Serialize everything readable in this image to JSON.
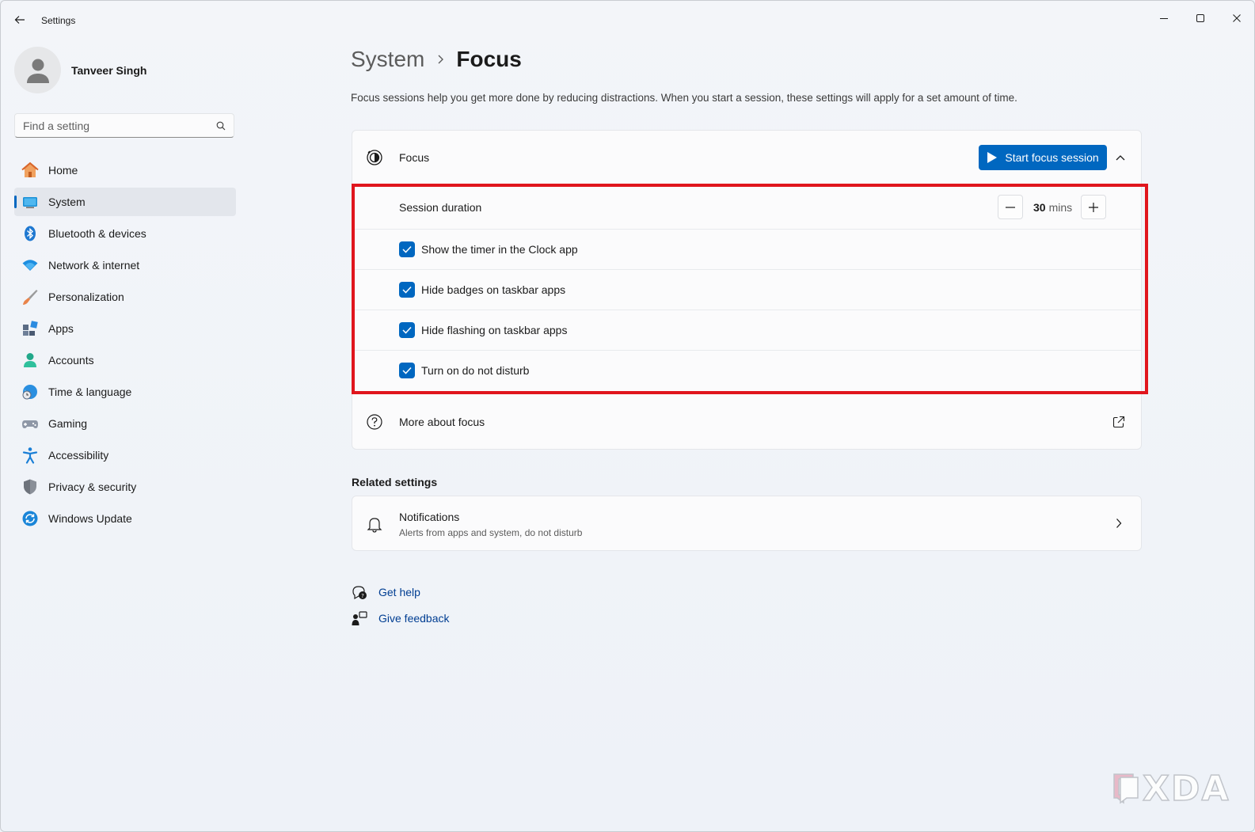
{
  "window": {
    "app_title": "Settings"
  },
  "profile": {
    "user_name": "Tanveer Singh"
  },
  "search": {
    "placeholder": "Find a setting"
  },
  "sidebar": {
    "items": [
      {
        "label": "Home",
        "icon": "home-icon"
      },
      {
        "label": "System",
        "icon": "system-icon",
        "active": true
      },
      {
        "label": "Bluetooth & devices",
        "icon": "bluetooth-icon"
      },
      {
        "label": "Network & internet",
        "icon": "wifi-icon"
      },
      {
        "label": "Personalization",
        "icon": "brush-icon"
      },
      {
        "label": "Apps",
        "icon": "apps-icon"
      },
      {
        "label": "Accounts",
        "icon": "accounts-icon"
      },
      {
        "label": "Time & language",
        "icon": "globe-clock-icon"
      },
      {
        "label": "Gaming",
        "icon": "gamepad-icon"
      },
      {
        "label": "Accessibility",
        "icon": "accessibility-icon"
      },
      {
        "label": "Privacy & security",
        "icon": "shield-icon"
      },
      {
        "label": "Windows Update",
        "icon": "update-icon"
      }
    ]
  },
  "breadcrumb": {
    "parent": "System",
    "current": "Focus"
  },
  "page": {
    "description": "Focus sessions help you get more done by reducing distractions. When you start a session, these settings will apply for a set amount of time."
  },
  "focus_card": {
    "title": "Focus",
    "start_button": "Start focus session",
    "session_duration_label": "Session duration",
    "session_value": "30",
    "session_unit": "mins",
    "options": [
      {
        "label": "Show the timer in the Clock app",
        "checked": true
      },
      {
        "label": "Hide badges on taskbar apps",
        "checked": true
      },
      {
        "label": "Hide flashing on taskbar apps",
        "checked": true
      },
      {
        "label": "Turn on do not disturb",
        "checked": true
      }
    ],
    "more_label": "More about focus"
  },
  "related": {
    "title": "Related settings",
    "notifications_title": "Notifications",
    "notifications_subtitle": "Alerts from apps and system, do not disturb"
  },
  "links": {
    "get_help": "Get help",
    "give_feedback": "Give feedback"
  },
  "watermark": {
    "text": "XDA"
  },
  "colors": {
    "accent": "#0067c0",
    "highlight": "#e0151d",
    "link": "#003e92"
  }
}
